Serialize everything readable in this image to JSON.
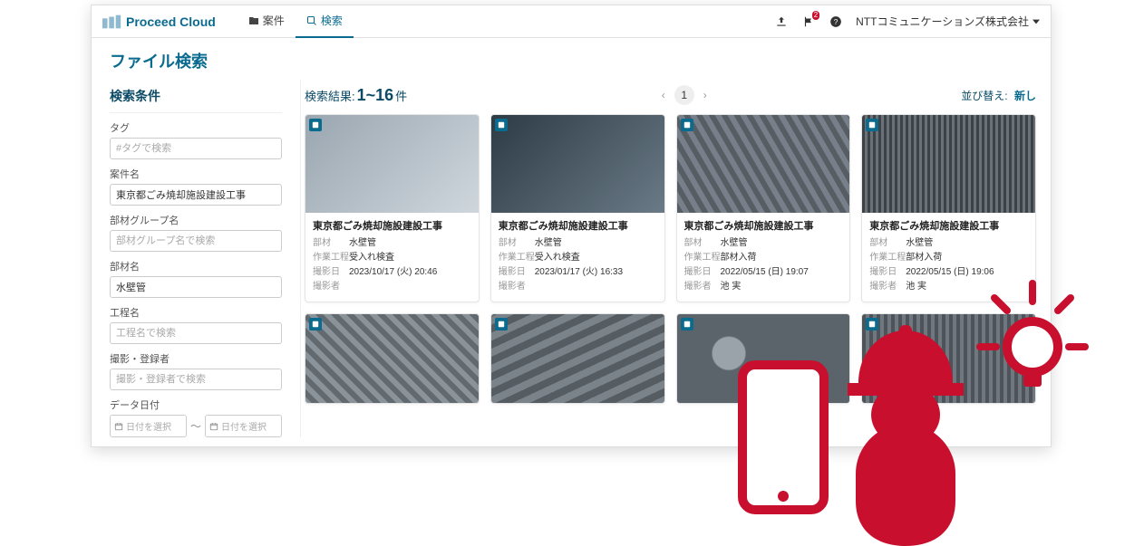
{
  "brand": "Proceed Cloud",
  "tabs": {
    "cases": "案件",
    "search": "検索"
  },
  "header": {
    "org": "NTTコミュニケーションズ株式会社",
    "notif_count": "2"
  },
  "page_title": "ファイル検索",
  "sidebar": {
    "heading": "検索条件",
    "tag_label": "タグ",
    "tag_placeholder": "#タグで検索",
    "project_label": "案件名",
    "project_value": "東京都ごみ焼却施設建設工事",
    "group_label": "部材グループ名",
    "group_placeholder": "部材グループ名で検索",
    "part_label": "部材名",
    "part_value": "水壁管",
    "process_label": "工程名",
    "process_placeholder": "工程名で検索",
    "author_label": "撮影・登録者",
    "author_placeholder": "撮影・登録者で検索",
    "date_label": "データ日付",
    "date_placeholder": "日付を選択",
    "date_sep": "〜"
  },
  "results": {
    "label": "検索結果:",
    "range": "1~16",
    "unit": "件",
    "page": "1",
    "sort_label": "並び替え:",
    "sort_value": "新し"
  },
  "meta_keys": {
    "part": "部材",
    "process": "作業工程",
    "date": "撮影日",
    "author": "撮影者"
  },
  "cards": [
    {
      "title": "東京都ごみ焼却施設建設工事",
      "part": "水壁管",
      "process": "受入れ検査",
      "date": "2023/10/17 (火) 20:46",
      "author": ""
    },
    {
      "title": "東京都ごみ焼却施設建設工事",
      "part": "水壁管",
      "process": "受入れ検査",
      "date": "2023/01/17 (火) 16:33",
      "author": ""
    },
    {
      "title": "東京都ごみ焼却施設建設工事",
      "part": "水壁管",
      "process": "部材入荷",
      "date": "2022/05/15 (日) 19:07",
      "author": "池 実"
    },
    {
      "title": "東京都ごみ焼却施設建設工事",
      "part": "水壁管",
      "process": "部材入荷",
      "date": "2022/05/15 (日) 19:06",
      "author": "池 実"
    }
  ]
}
